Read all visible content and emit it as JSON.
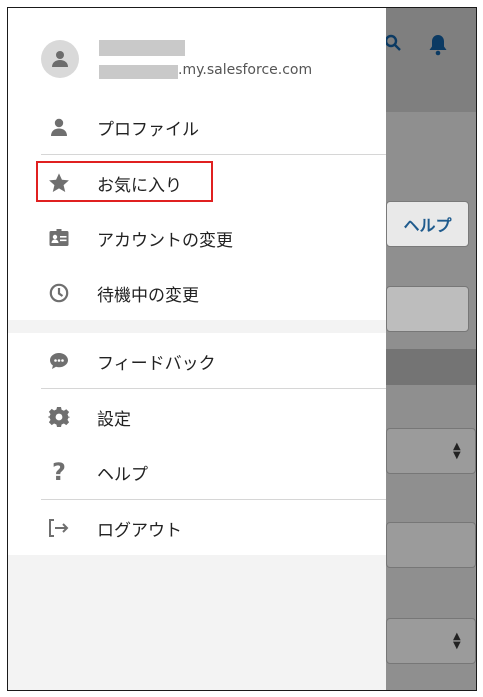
{
  "user": {
    "domain_suffix": ".my.salesforce.com"
  },
  "menu": {
    "items": [
      {
        "label": "プロファイル",
        "icon": "user-icon"
      },
      {
        "label": "お気に入り",
        "icon": "star-icon"
      },
      {
        "label": "アカウントの変更",
        "icon": "account-card-icon"
      },
      {
        "label": "待機中の変更",
        "icon": "clock-icon"
      },
      {
        "label": "フィードバック",
        "icon": "feedback-icon"
      },
      {
        "label": "設定",
        "icon": "gear-icon"
      },
      {
        "label": "ヘルプ",
        "icon": "question-icon"
      },
      {
        "label": "ログアウト",
        "icon": "logout-icon"
      }
    ]
  },
  "background": {
    "help_button_label": "ヘルプ"
  },
  "colors": {
    "highlight": "#e02020",
    "help_text": "#1f5b8d"
  }
}
